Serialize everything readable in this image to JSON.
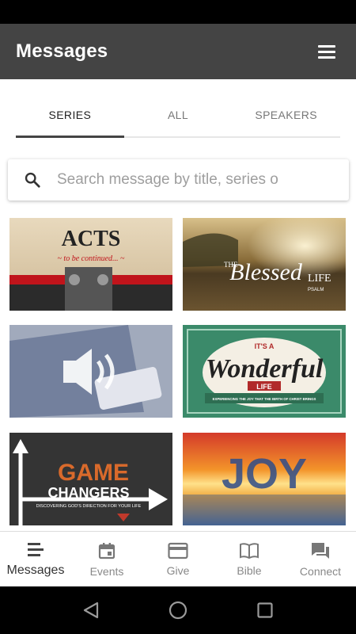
{
  "app_bar": {
    "title": "Messages"
  },
  "tabs": [
    {
      "label": "SERIES"
    },
    {
      "label": "ALL"
    },
    {
      "label": "SPEAKERS"
    }
  ],
  "search": {
    "placeholder": "Search message by title, series o"
  },
  "series": [
    {
      "art_text": "ACTS",
      "art_subtext": "~ to be continued... ~"
    },
    {
      "art_text": "Blessed",
      "art_subtext": "THE",
      "art_extra": "LIFE",
      "art_extra2": "PSALM"
    },
    {
      "art_text": ""
    },
    {
      "art_text": "Wonderful",
      "art_subtext": "IT'S A",
      "art_extra": "LIFE",
      "art_extra2": "EXPERIENCING THE JOY THAT THE BIRTH OF CHRIST BRINGS"
    },
    {
      "art_text": "GAME",
      "art_subtext": "CHANGERS",
      "art_extra": "DISCOVERING GOD'S DIRECTION FOR YOUR LIFE"
    },
    {
      "art_text": "JOY"
    }
  ],
  "bottom_nav": [
    {
      "label": "Messages",
      "icon": "messages-icon"
    },
    {
      "label": "Events",
      "icon": "calendar-icon"
    },
    {
      "label": "Give",
      "icon": "card-icon"
    },
    {
      "label": "Bible",
      "icon": "book-icon"
    },
    {
      "label": "Connect",
      "icon": "chat-icon"
    }
  ],
  "colors": {
    "app_bar": "#444444",
    "active_tab_indicator": "#444444"
  }
}
